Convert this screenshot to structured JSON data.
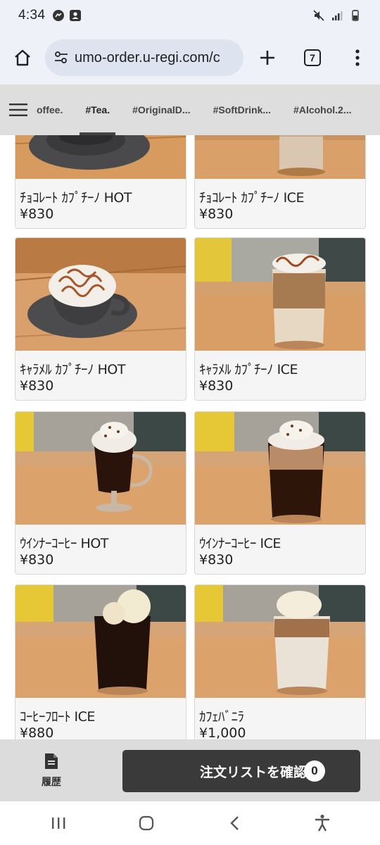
{
  "status_bar": {
    "time": "4:34"
  },
  "browser": {
    "url": "umo-order.u-regi.com/c",
    "tab_count": "7"
  },
  "categories": [
    {
      "label": "offee."
    },
    {
      "label": "#Tea."
    },
    {
      "label": "#OriginalD..."
    },
    {
      "label": "#SoftDrink..."
    },
    {
      "label": "#Alcohol.2..."
    }
  ],
  "active_category": "#Tea.",
  "products": [
    {
      "name": "ﾁｮｺﾚｰﾄ ｶﾌﾟﾁｰﾉ HOT",
      "price": "¥830"
    },
    {
      "name": "ﾁｮｺﾚｰﾄ ｶﾌﾟﾁｰﾉ ICE",
      "price": "¥830"
    },
    {
      "name": "ｷｬﾗﾒﾙ ｶﾌﾟﾁｰﾉ HOT",
      "price": "¥830"
    },
    {
      "name": "ｷｬﾗﾒﾙ ｶﾌﾟﾁｰﾉ ICE",
      "price": "¥830"
    },
    {
      "name": "ｳｲﾝﾅｰｺｰﾋｰ HOT",
      "price": "¥830"
    },
    {
      "name": "ｳｲﾝﾅｰｺｰﾋｰ ICE",
      "price": "¥830"
    },
    {
      "name": "ｺｰﾋｰﾌﾛｰﾄ ICE",
      "price": "¥880"
    },
    {
      "name": "ｶﾌｪﾊﾞﾆﾗ",
      "price": "¥1,000"
    }
  ],
  "action_bar": {
    "history_label": "履歴",
    "order_label": "注文リストを確認",
    "order_count": "0"
  },
  "colors": {
    "accent_dark": "#3a3a3a",
    "nav_bg": "#dedede",
    "chrome_bg": "#eef1f8"
  },
  "icons": {
    "home": "home-icon",
    "site_settings": "tune-icon",
    "new_tab": "plus-icon",
    "tabs": "tab-switcher-icon",
    "menu": "more-vert-icon",
    "hamburger": "hamburger-icon",
    "history": "document-icon",
    "recents": "recents-icon",
    "android_home": "android-home-icon",
    "back": "back-icon",
    "accessibility": "accessibility-icon"
  }
}
